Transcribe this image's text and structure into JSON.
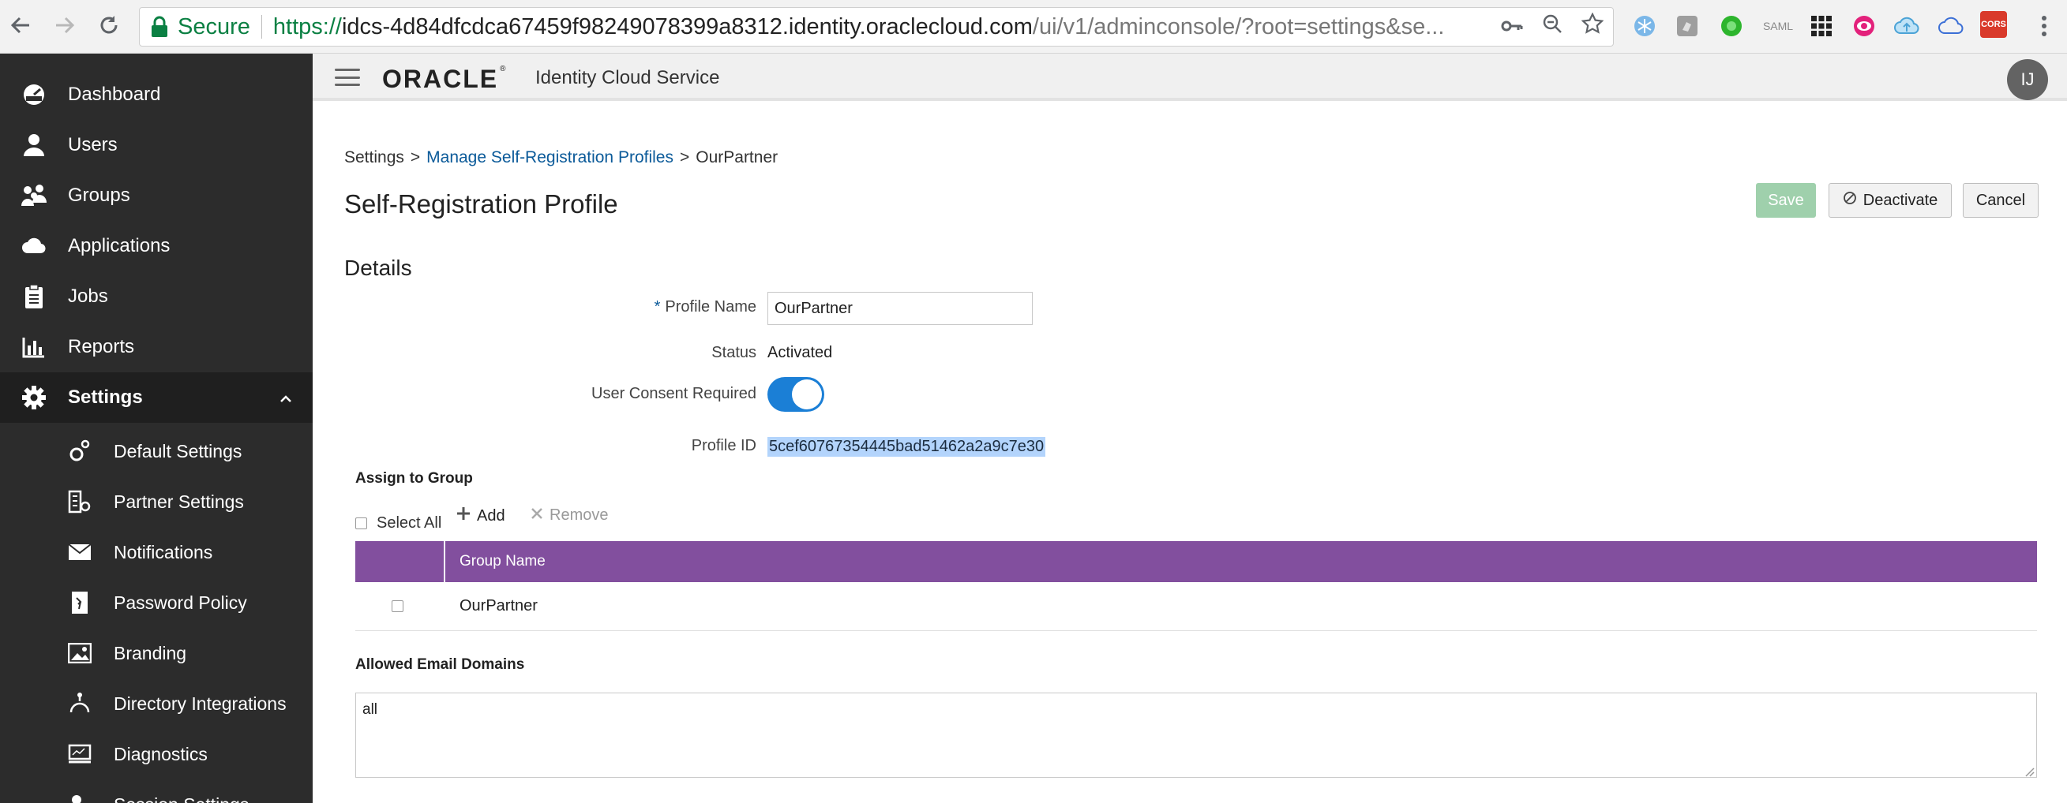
{
  "browser": {
    "secure_label": "Secure",
    "url_scheme": "https://",
    "url_host": "idcs-4d84dfcdca67459f98249078399a8312.identity.oraclecloud.com",
    "url_path": "/ui/v1/adminconsole/?root=settings&se...",
    "extension_icons": [
      "snowflake-icon",
      "square-icon",
      "green-dot-icon",
      "saml-icon",
      "grid-icon",
      "eye-icon",
      "cloud-upload-icon",
      "cloud-icon",
      "cors-icon"
    ],
    "saml_text": "SAML",
    "cors_text": "CORS"
  },
  "header": {
    "logo": "ORACLE",
    "product": "Identity Cloud Service",
    "avatar_initials": "IJ"
  },
  "sidebar": {
    "items": [
      {
        "label": "Dashboard",
        "icon": "dashboard-icon"
      },
      {
        "label": "Users",
        "icon": "user-icon"
      },
      {
        "label": "Groups",
        "icon": "groups-icon"
      },
      {
        "label": "Applications",
        "icon": "cloud-icon"
      },
      {
        "label": "Jobs",
        "icon": "jobs-icon"
      },
      {
        "label": "Reports",
        "icon": "reports-icon"
      },
      {
        "label": "Settings",
        "icon": "gear-icon"
      }
    ],
    "settings_sub": [
      {
        "label": "Default Settings",
        "icon": "gears-icon"
      },
      {
        "label": "Partner Settings",
        "icon": "partner-icon"
      },
      {
        "label": "Notifications",
        "icon": "envelope-icon"
      },
      {
        "label": "Password Policy",
        "icon": "password-icon"
      },
      {
        "label": "Branding",
        "icon": "image-icon"
      },
      {
        "label": "Directory Integrations",
        "icon": "directory-icon"
      },
      {
        "label": "Diagnostics",
        "icon": "monitor-icon"
      },
      {
        "label": "Session Settings",
        "icon": "session-icon"
      }
    ]
  },
  "breadcrumb": {
    "root": "Settings",
    "link": "Manage Self-Registration Profiles",
    "current": "OurPartner",
    "separator": ">"
  },
  "page": {
    "title": "Self-Registration Profile",
    "save": "Save",
    "deactivate": "Deactivate",
    "cancel": "Cancel",
    "section": "Details"
  },
  "form": {
    "required_mark": "*",
    "profile_name_label": "Profile Name",
    "profile_name_value": "OurPartner",
    "status_label": "Status",
    "status_value": "Activated",
    "consent_label": "User Consent Required",
    "consent_on": true,
    "profile_id_label": "Profile ID",
    "profile_id_value": "5cef60767354445bad51462a2a9c7e30"
  },
  "assign": {
    "title": "Assign to Group",
    "select_all": "Select All",
    "add": "Add",
    "remove": "Remove",
    "column": "Group Name",
    "rows": [
      "OurPartner"
    ]
  },
  "domains": {
    "title": "Allowed Email Domains",
    "value": "all"
  }
}
